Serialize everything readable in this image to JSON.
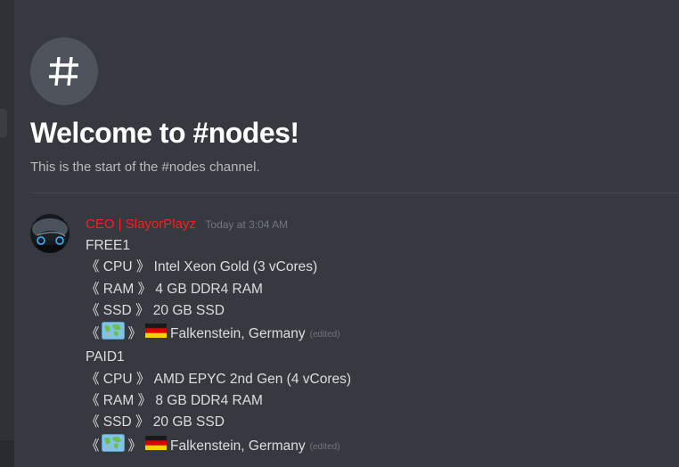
{
  "channel": {
    "welcome_title": "Welcome to #nodes!",
    "welcome_subtitle": "This is the start of the #nodes channel."
  },
  "message": {
    "author": "CEO | SlayorPlayz",
    "timestamp": "Today at 3:04 AM",
    "author_color": "#ff1d1d",
    "blocks": [
      {
        "title": "FREE1",
        "cpu": "《 CPU 》 Intel Xeon Gold (3 vCores)",
        "ram": "《 RAM 》 4 GB DDR4 RAM",
        "ssd": "《 SSD 》 20 GB SSD",
        "loc_open": "《",
        "loc_close": "》",
        "location": "Falkenstein, Germany",
        "edited": "(edited)"
      },
      {
        "title": "PAID1",
        "cpu": "《 CPU 》 AMD EPYC 2nd Gen (4 vCores)",
        "ram": "《 RAM 》 8 GB DDR4 RAM",
        "ssd": "《 SSD 》 20 GB SSD",
        "loc_open": "《",
        "loc_close": "》",
        "location": "Falkenstein, Germany",
        "edited": "(edited)"
      }
    ]
  },
  "icons": {
    "channel": "hash-icon",
    "map": "world-map-icon",
    "flag": "germany-flag-icon"
  },
  "colors": {
    "background": "#36393f",
    "text": "#dcddde",
    "muted": "#72767d"
  }
}
